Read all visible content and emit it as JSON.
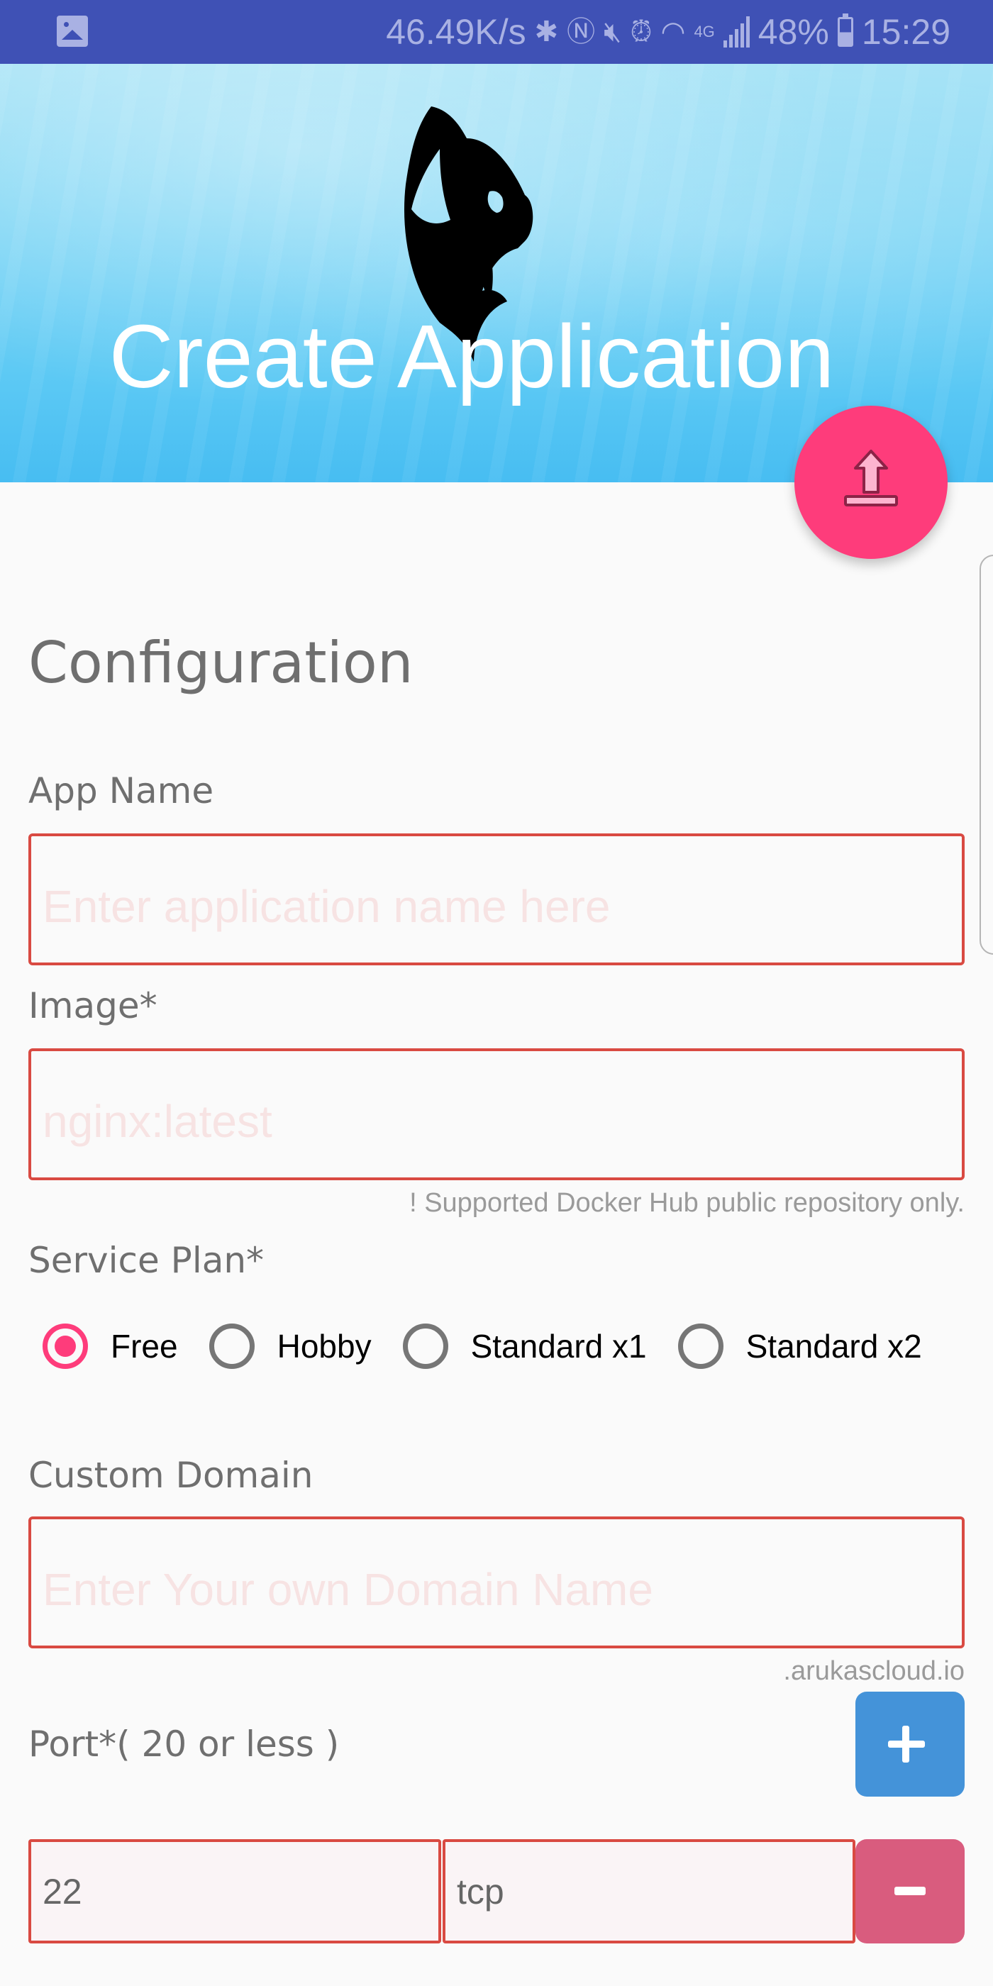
{
  "status_bar": {
    "net_speed": "46.49K/s",
    "icons": [
      "gallery-icon",
      "bluetooth-icon",
      "nfc-icon",
      "mute-icon",
      "alarm-icon",
      "wifi-icon",
      "4g-icon",
      "signal-icon",
      "battery-icon"
    ],
    "network_type": "4G",
    "battery": "48%",
    "time": "15:29"
  },
  "header": {
    "title": "Create Application",
    "logo": "orca-icon"
  },
  "fab": {
    "icon": "upload-icon",
    "color": "#fe3c7b"
  },
  "form": {
    "section_title": "Configuration",
    "app_name": {
      "label": "App Name",
      "value": "",
      "placeholder": "Enter application name here"
    },
    "image": {
      "label": "Image*",
      "value": "",
      "placeholder": "nginx:latest",
      "hint": "! Supported Docker Hub public repository only."
    },
    "service_plan": {
      "label": "Service Plan*",
      "options": [
        {
          "label": "Free",
          "checked": true
        },
        {
          "label": "Hobby",
          "checked": false
        },
        {
          "label": "Standard x1",
          "checked": false
        },
        {
          "label": "Standard x2",
          "checked": false
        }
      ]
    },
    "custom_domain": {
      "label": "Custom Domain",
      "value": "",
      "placeholder": "Enter Your own Domain Name",
      "suffix": ".arukascloud.io"
    },
    "port": {
      "label": "Port*( 20 or less )",
      "add_label": "+",
      "remove_label": "−",
      "rows": [
        {
          "port": "22",
          "protocol": "tcp"
        }
      ]
    }
  },
  "colors": {
    "status_bar": "#3f51b5",
    "accent": "#fe3c7b",
    "error_border": "#d94a42",
    "add_button": "#4493d9",
    "remove_button": "#d95c7e"
  }
}
